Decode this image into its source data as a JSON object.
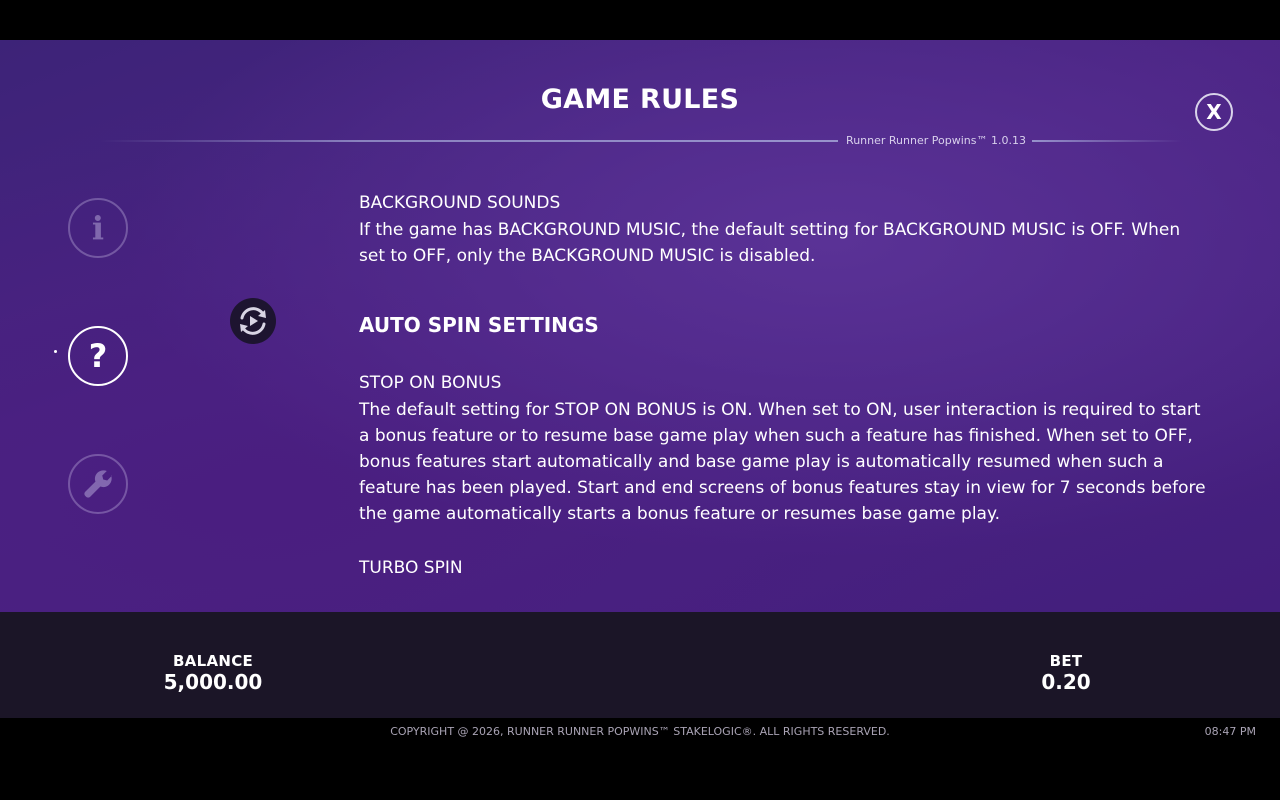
{
  "header": {
    "title": "GAME RULES",
    "version": "Runner Runner Popwins™ 1.0.13",
    "close_label": "X"
  },
  "sidebar": {
    "items": [
      {
        "name": "info",
        "glyph": "i",
        "icon": "info-icon",
        "active": false
      },
      {
        "name": "help",
        "glyph": "?",
        "icon": "question-icon",
        "active": true
      },
      {
        "name": "settings",
        "glyph": "",
        "icon": "wrench-icon",
        "active": false
      }
    ]
  },
  "content": {
    "background_sounds": {
      "heading": "BACKGROUND SOUNDS",
      "text": "If the game has BACKGROUND MUSIC, the default setting for BACKGROUND MUSIC is OFF. When set to OFF, only the BACKGROUND MUSIC is disabled."
    },
    "auto_spin": {
      "heading": "AUTO SPIN SETTINGS",
      "icon": "autoplay-icon"
    },
    "stop_on_bonus": {
      "heading": "STOP ON BONUS",
      "text": "The default setting for STOP ON BONUS is ON. When set to ON, user interaction is required to start a bonus feature or to resume base game play when such a feature has finished. When set to OFF, bonus features start automatically and base game play is automatically resumed when such a feature has been played. Start and end screens of bonus features stay in view for 7 seconds before the game automatically starts a bonus feature or resumes base game play."
    },
    "turbo_spin": {
      "heading": "TURBO SPIN"
    }
  },
  "bottom_bar": {
    "balance_label": "BALANCE",
    "balance_value": "5,000.00",
    "bet_label": "BET",
    "bet_value": "0.20"
  },
  "footer": {
    "copyright": "COPYRIGHT @ 2026, RUNNER RUNNER POPWINS™ STAKELOGIC®. ALL RIGHTS RESERVED.",
    "time": "08:47 PM"
  },
  "colors": {
    "panel": "#4b2484",
    "bottom_bar": "#1b1527",
    "text": "#ffffff"
  }
}
